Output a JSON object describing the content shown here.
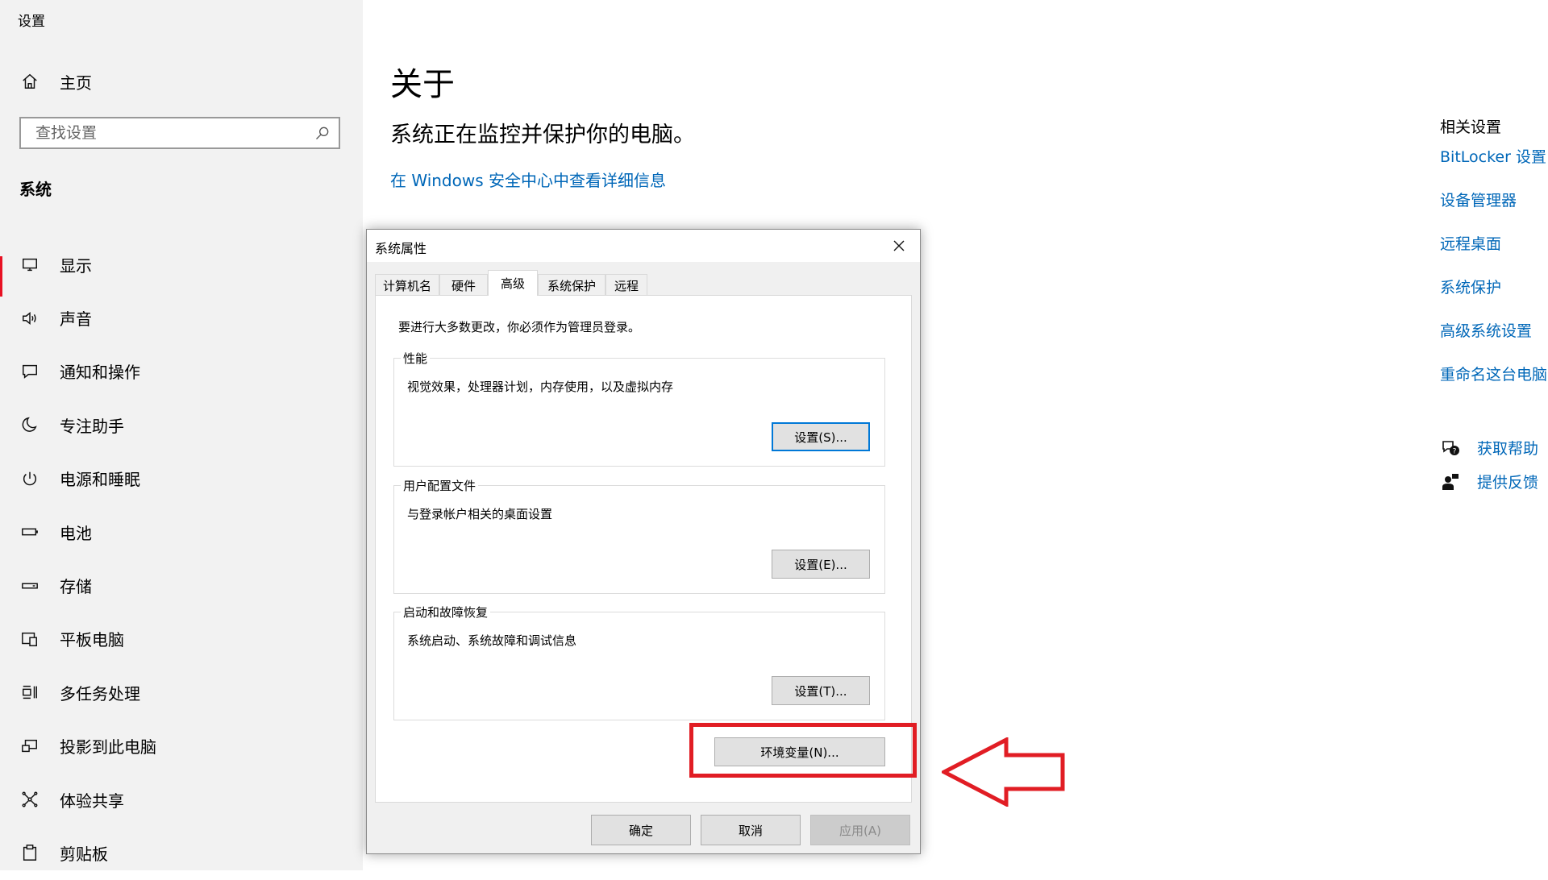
{
  "window": {
    "title": "设置"
  },
  "sidebar": {
    "home_label": "主页",
    "search_placeholder": "查找设置",
    "section_title": "系统",
    "items": [
      {
        "label": "显示",
        "icon": "monitor-icon"
      },
      {
        "label": "声音",
        "icon": "speaker-icon"
      },
      {
        "label": "通知和操作",
        "icon": "notification-icon"
      },
      {
        "label": "专注助手",
        "icon": "moon-icon"
      },
      {
        "label": "电源和睡眠",
        "icon": "power-icon"
      },
      {
        "label": "电池",
        "icon": "battery-icon"
      },
      {
        "label": "存储",
        "icon": "storage-icon"
      },
      {
        "label": "平板电脑",
        "icon": "tablet-icon"
      },
      {
        "label": "多任务处理",
        "icon": "multitask-icon"
      },
      {
        "label": "投影到此电脑",
        "icon": "project-icon"
      },
      {
        "label": "体验共享",
        "icon": "share-icon"
      },
      {
        "label": "剪贴板",
        "icon": "clipboard-icon"
      }
    ]
  },
  "main": {
    "title": "关于",
    "status": "系统正在监控并保护你的电脑。",
    "security_link": "在 Windows 安全中心中查看详细信息"
  },
  "related": {
    "title": "相关设置",
    "links": [
      "BitLocker 设置",
      "设备管理器",
      "远程桌面",
      "系统保护",
      "高级系统设置",
      "重命名这台电脑"
    ],
    "get_help": "获取帮助",
    "feedback": "提供反馈"
  },
  "dialog": {
    "title": "系统属性",
    "tabs": [
      "计算机名",
      "硬件",
      "高级",
      "系统保护",
      "远程"
    ],
    "active_tab": "高级",
    "admin_note": "要进行大多数更改，你必须作为管理员登录。",
    "groups": [
      {
        "legend": "性能",
        "description": "视觉效果，处理器计划，内存使用，以及虚拟内存",
        "button": "设置(S)..."
      },
      {
        "legend": "用户配置文件",
        "description": "与登录帐户相关的桌面设置",
        "button": "设置(E)..."
      },
      {
        "legend": "启动和故障恢复",
        "description": "系统启动、系统故障和调试信息",
        "button": "设置(T)..."
      }
    ],
    "env_button": "环境变量(N)...",
    "ok": "确定",
    "cancel": "取消",
    "apply": "应用(A)"
  },
  "colors": {
    "link": "#0067b8",
    "annotation_red": "#e11d24",
    "focus_blue": "#0078d7"
  }
}
